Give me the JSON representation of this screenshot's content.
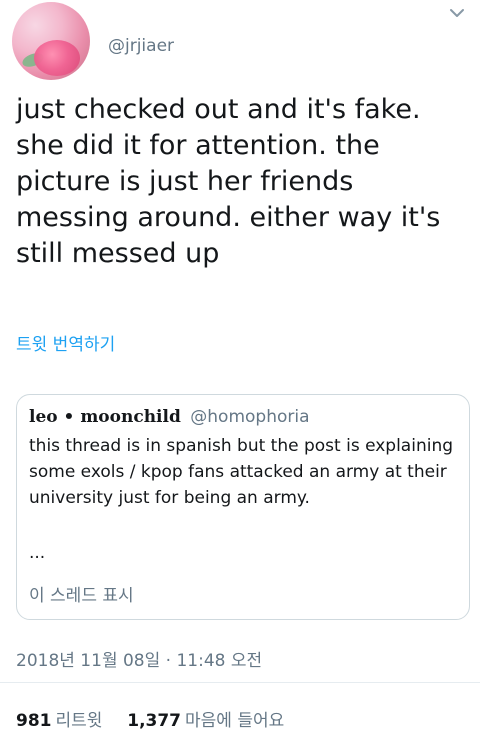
{
  "author": {
    "handle": "@jrjiaer",
    "avatar_icon": "profile-avatar-flower-photo"
  },
  "tweet": {
    "text": "just checked out and it's fake. she did it for attention. the picture is just her friends messing around. either way it's still messed up",
    "translate_label": "트윗 번역하기",
    "menu_icon": "chevron-down-icon"
  },
  "quoted_tweet": {
    "name": "leo • moonchild",
    "handle": "@homophoria",
    "text": "this thread is in spanish but the post is explaining some exols / kpop fans attacked an army at their university just for being an army.",
    "ellipsis": "...",
    "show_thread_label": "이 스레드 표시"
  },
  "meta": {
    "timestamp": "2018년 11월 08일 · 11:48 오전"
  },
  "stats": {
    "retweets_count": "981",
    "retweets_label": "리트윗",
    "likes_count": "1,377",
    "likes_label": "마음에 들어요"
  },
  "colors": {
    "link": "#1da1f2",
    "text_primary": "#14171a",
    "text_secondary": "#657786",
    "border": "#cfd9de"
  }
}
